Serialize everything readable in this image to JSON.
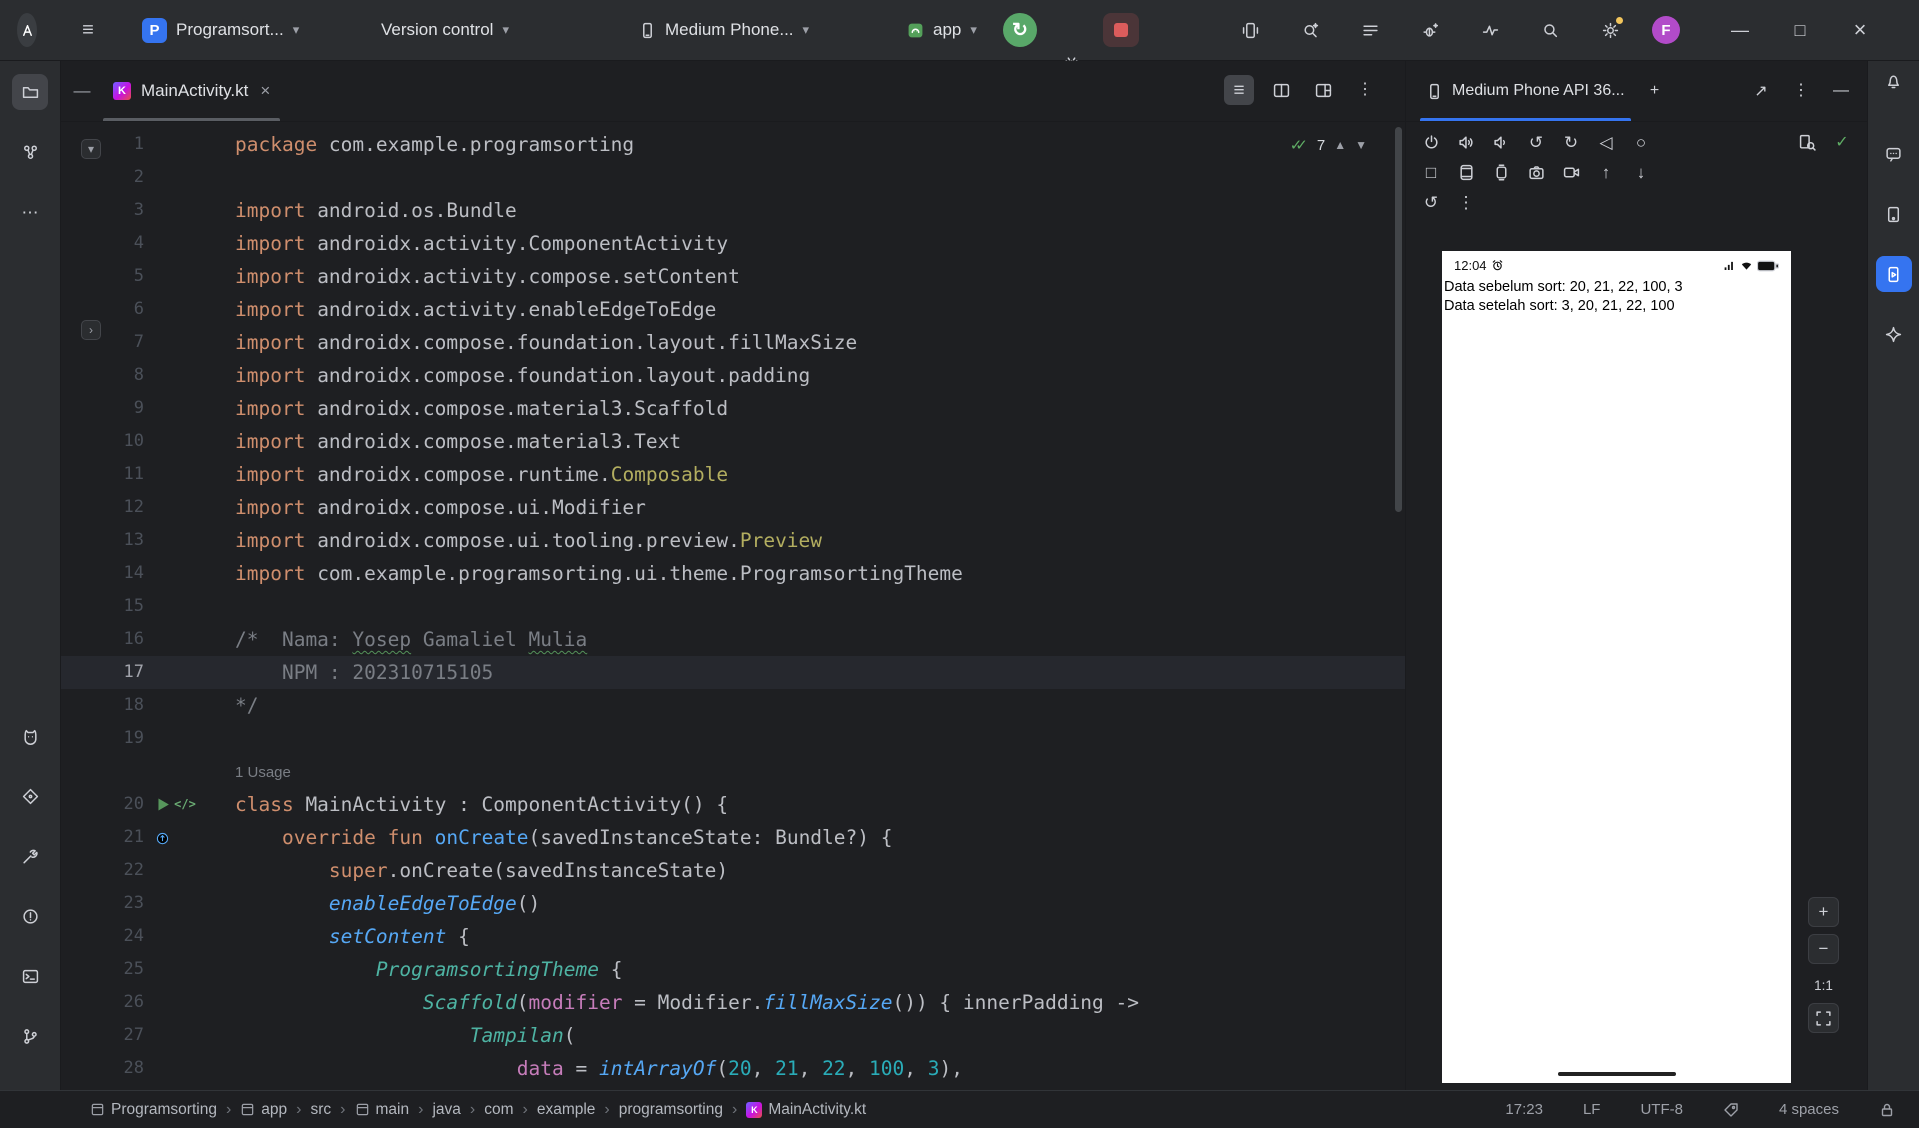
{
  "titlebar": {
    "project": {
      "badge": "P",
      "label": "Programsort..."
    },
    "vcs_label": "Version control",
    "device_label": "Medium Phone...",
    "run_config_label": "app",
    "avatar_letter": "F",
    "right_icons": [
      "device-mirroring",
      "ai-search",
      "structure",
      "gemini-bug",
      "profiler"
    ]
  },
  "left_stripe": {
    "top": [
      "project-folder",
      "resource-manager",
      "more-tools"
    ],
    "top_active": "project-folder",
    "bottom": [
      "logcat",
      "app-quality-insights",
      "build",
      "problems",
      "terminal",
      "version-control-branch"
    ]
  },
  "right_stripe": {
    "items": [
      "notifications",
      "assistant",
      "device-manager",
      "running-devices",
      "gemini"
    ],
    "active": "running-devices"
  },
  "editor": {
    "tab_label": "MainActivity.kt",
    "inspection_count": "7",
    "code_lines": [
      {
        "n": 1,
        "segs": [
          [
            "kw",
            "package"
          ],
          [
            "pl",
            " com.example.programsorting"
          ]
        ]
      },
      {
        "n": 2,
        "segs": []
      },
      {
        "n": 3,
        "segs": [
          [
            "kw",
            "import"
          ],
          [
            "pl",
            " android.os.Bundle"
          ]
        ]
      },
      {
        "n": 4,
        "segs": [
          [
            "kw",
            "import"
          ],
          [
            "pl",
            " androidx.activity.ComponentActivity"
          ]
        ]
      },
      {
        "n": 5,
        "segs": [
          [
            "kw",
            "import"
          ],
          [
            "pl",
            " androidx.activity.compose.setContent"
          ]
        ]
      },
      {
        "n": 6,
        "segs": [
          [
            "kw",
            "import"
          ],
          [
            "pl",
            " androidx.activity.enableEdgeToEdge"
          ]
        ]
      },
      {
        "n": 7,
        "segs": [
          [
            "kw",
            "import"
          ],
          [
            "pl",
            " androidx.compose.foundation.layout.fillMaxSize"
          ]
        ]
      },
      {
        "n": 8,
        "segs": [
          [
            "kw",
            "import"
          ],
          [
            "pl",
            " androidx.compose.foundation.layout.padding"
          ]
        ]
      },
      {
        "n": 9,
        "segs": [
          [
            "kw",
            "import"
          ],
          [
            "pl",
            " androidx.compose.material3.Scaffold"
          ]
        ]
      },
      {
        "n": 10,
        "segs": [
          [
            "kw",
            "import"
          ],
          [
            "pl",
            " androidx.compose.material3.Text"
          ]
        ]
      },
      {
        "n": 11,
        "segs": [
          [
            "kw",
            "import"
          ],
          [
            "pl",
            " androidx.compose.runtime."
          ],
          [
            "an",
            "Composable"
          ]
        ]
      },
      {
        "n": 12,
        "segs": [
          [
            "kw",
            "import"
          ],
          [
            "pl",
            " androidx.compose.ui.Modifier"
          ]
        ]
      },
      {
        "n": 13,
        "segs": [
          [
            "kw",
            "import"
          ],
          [
            "pl",
            " androidx.compose.ui.tooling.preview."
          ],
          [
            "an",
            "Preview"
          ]
        ]
      },
      {
        "n": 14,
        "segs": [
          [
            "kw",
            "import"
          ],
          [
            "pl",
            " com.example.programsorting.ui.theme.ProgramsortingTheme"
          ]
        ]
      },
      {
        "n": 15,
        "segs": []
      },
      {
        "n": 16,
        "segs": [
          [
            "cm",
            "/*  Nama: "
          ],
          [
            "cmw",
            "Yosep"
          ],
          [
            "cm",
            " Gamaliel "
          ],
          [
            "cmw",
            "Mulia"
          ]
        ]
      },
      {
        "n": 17,
        "current": true,
        "segs": [
          [
            "cm",
            "    NPM : 202310715105"
          ]
        ]
      },
      {
        "n": 18,
        "segs": [
          [
            "cm",
            "*/"
          ]
        ]
      },
      {
        "n": 19,
        "segs": []
      },
      {
        "inlay": "1 Usage"
      },
      {
        "n": 20,
        "gutter": [
          "run",
          "compose"
        ],
        "segs": [
          [
            "kw",
            "class"
          ],
          [
            "pl",
            " MainActivity : ComponentActivity() {"
          ]
        ]
      },
      {
        "n": 21,
        "gutter": [
          "override"
        ],
        "segs": [
          [
            "pl",
            "    "
          ],
          [
            "kw",
            "override"
          ],
          [
            "pl",
            " "
          ],
          [
            "kw",
            "fun"
          ],
          [
            "dc",
            " onCreate"
          ],
          [
            "pl",
            "(savedInstanceState: Bundle?) {"
          ]
        ]
      },
      {
        "n": 22,
        "segs": [
          [
            "pl",
            "        "
          ],
          [
            "kw",
            "super"
          ],
          [
            "pl",
            ".onCreate(savedInstanceState)"
          ]
        ]
      },
      {
        "n": 23,
        "segs": [
          [
            "pl",
            "        "
          ],
          [
            "fn",
            "enableEdgeToEdge"
          ],
          [
            "pl",
            "()"
          ]
        ]
      },
      {
        "n": 24,
        "segs": [
          [
            "pl",
            "        "
          ],
          [
            "fn",
            "setContent"
          ],
          [
            "pl",
            " {"
          ]
        ]
      },
      {
        "n": 25,
        "segs": [
          [
            "pl",
            "            "
          ],
          [
            "cp",
            "ProgramsortingTheme"
          ],
          [
            "pl",
            " {"
          ]
        ]
      },
      {
        "n": 26,
        "segs": [
          [
            "pl",
            "                "
          ],
          [
            "cp",
            "Scaffold"
          ],
          [
            "pl",
            "("
          ],
          [
            "ag",
            "modifier"
          ],
          [
            "pl",
            " = Modifier."
          ],
          [
            "fn",
            "fillMaxSize"
          ],
          [
            "pl",
            "()) { innerPadding ->"
          ]
        ]
      },
      {
        "n": 27,
        "segs": [
          [
            "pl",
            "                    "
          ],
          [
            "cp",
            "Tampilan"
          ],
          [
            "pl",
            "("
          ]
        ]
      },
      {
        "n": 28,
        "segs": [
          [
            "pl",
            "                        "
          ],
          [
            "ag",
            "data"
          ],
          [
            "pl",
            " = "
          ],
          [
            "fn",
            "intArrayOf"
          ],
          [
            "pl",
            "("
          ],
          [
            "nm",
            "20"
          ],
          [
            "pl",
            ", "
          ],
          [
            "nm",
            "21"
          ],
          [
            "pl",
            ", "
          ],
          [
            "nm",
            "22"
          ],
          [
            "pl",
            ", "
          ],
          [
            "nm",
            "100"
          ],
          [
            "pl",
            ", "
          ],
          [
            "nm",
            "3"
          ],
          [
            "pl",
            "),"
          ]
        ]
      }
    ]
  },
  "device_panel": {
    "tab_label": "Medium Phone API 36...",
    "toolbar_row1": [
      "power",
      "volume-up",
      "volume-down",
      "rotate-left",
      "rotate-right",
      "back",
      "home"
    ],
    "toolbar_row1_right": [
      "screenshot-search",
      "deploy-check"
    ],
    "toolbar_row2": [
      "overview-square",
      "snapshot",
      "snapshot-alt",
      "camera",
      "record-video",
      "upload",
      "download"
    ],
    "toolbar_row3": [
      "reset",
      "more-vertical"
    ],
    "phone": {
      "status_time": "12:04",
      "line1": "Data sebelum sort: 20, 21, 22, 100, 3",
      "line2": "Data setelah sort: 3, 20, 21, 22, 100"
    },
    "zoom_label": "1:1"
  },
  "statusbar": {
    "breadcrumbs": [
      {
        "label": "Programsorting",
        "icon": "module"
      },
      {
        "label": "app",
        "icon": "module"
      },
      {
        "label": "src"
      },
      {
        "label": "main",
        "icon": "module"
      },
      {
        "label": "java"
      },
      {
        "label": "com"
      },
      {
        "label": "example"
      },
      {
        "label": "programsorting"
      },
      {
        "label": "MainActivity.kt",
        "icon": "kotlin"
      }
    ],
    "caret_position": "17:23",
    "line_ending": "LF",
    "encoding": "UTF-8",
    "indent": "4 spaces"
  }
}
